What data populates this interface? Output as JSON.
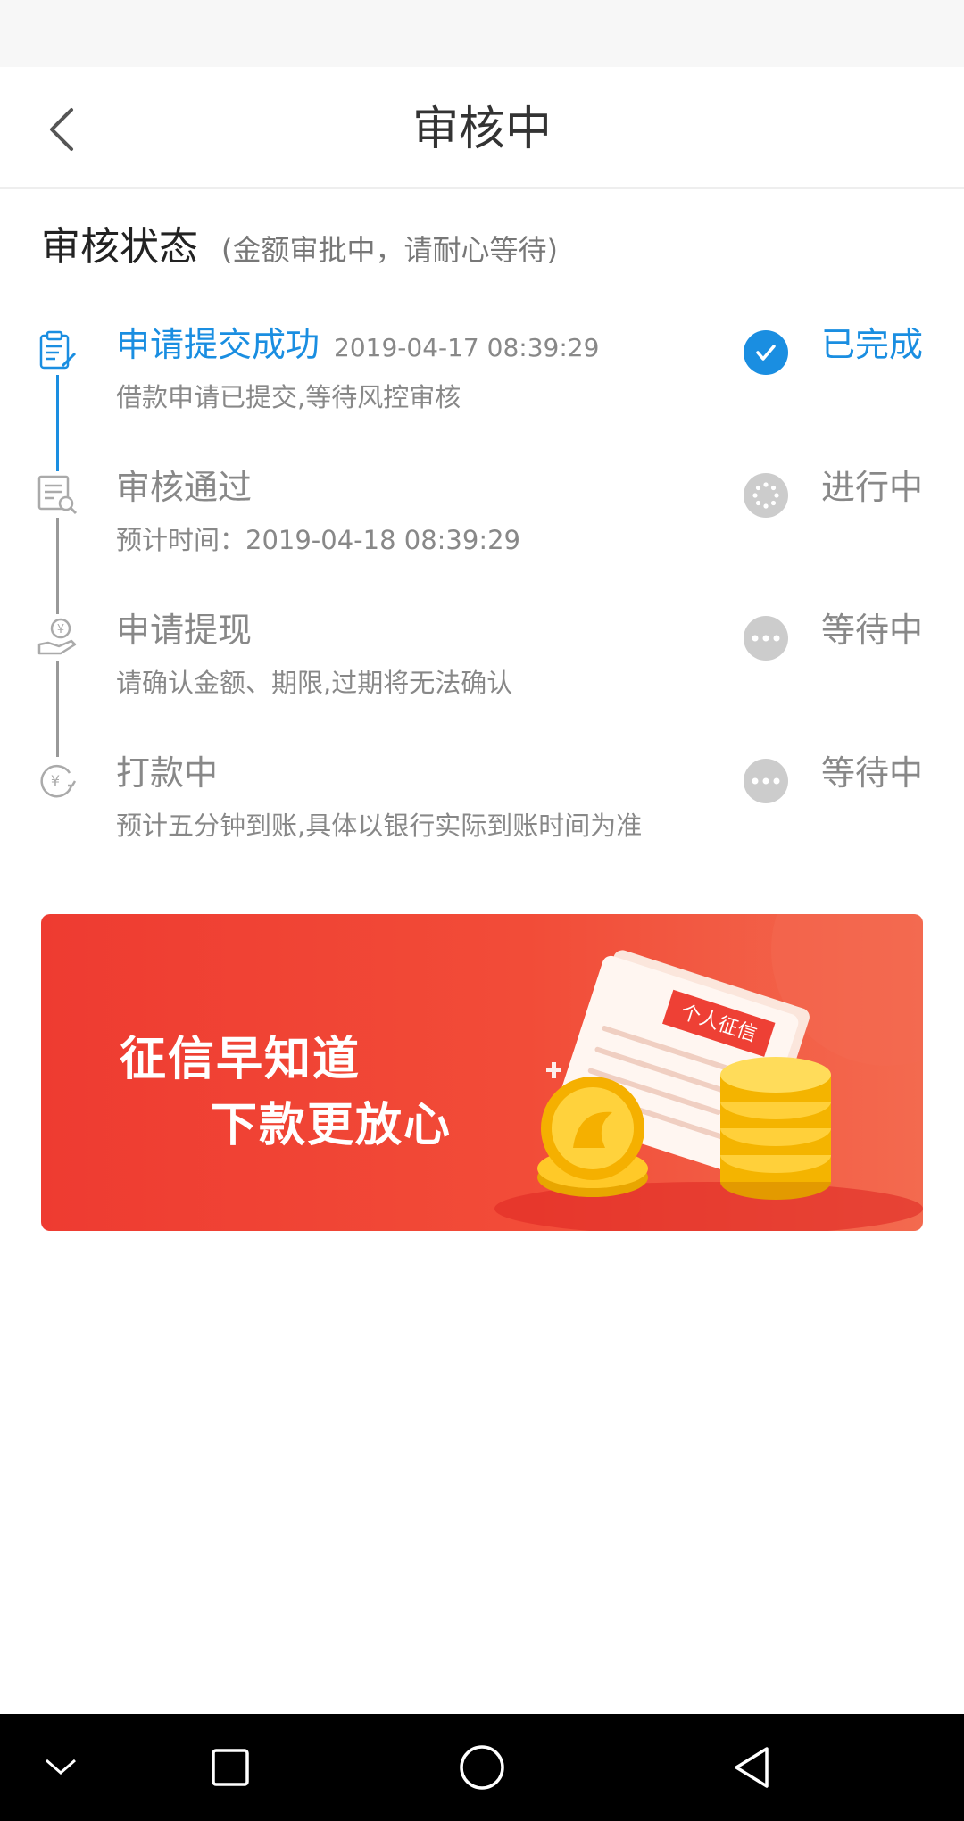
{
  "header": {
    "title": "审核中"
  },
  "section": {
    "title": "审核状态",
    "subtitle": "(金额审批中，请耐心等待)"
  },
  "steps": [
    {
      "title": "申请提交成功",
      "time": "2019-04-17 08:39:29",
      "desc": "借款申请已提交,等待风控审核",
      "status": "已完成",
      "state": "done"
    },
    {
      "title": "审核通过",
      "time": "",
      "desc": "预计时间：2019-04-18 08:39:29",
      "status": "进行中",
      "state": "progress"
    },
    {
      "title": "申请提现",
      "time": "",
      "desc": "请确认金额、期限,过期将无法确认",
      "status": "等待中",
      "state": "waiting"
    },
    {
      "title": "打款中",
      "time": "",
      "desc": "预计五分钟到账,具体以银行实际到账时间为准",
      "status": "等待中",
      "state": "waiting"
    }
  ],
  "banner": {
    "line1": "征信早知道",
    "line2": "下款更放心",
    "badge": "个人征信"
  },
  "icons": {
    "step1": "clipboard-edit-icon",
    "step2": "document-search-icon",
    "step3": "hand-money-icon",
    "step4": "yen-transfer-icon"
  },
  "colors": {
    "accent": "#1a8ee1",
    "gray": "#999999",
    "banner": "#ef3e33"
  }
}
